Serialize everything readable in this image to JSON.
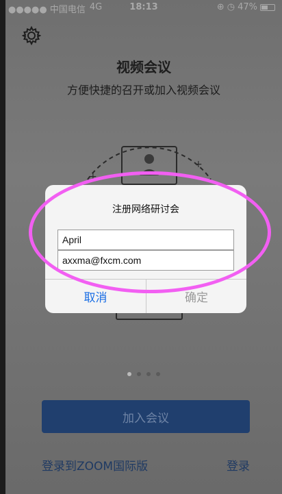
{
  "status_bar": {
    "carrier": "●●●●● 中国电信",
    "network": "4G",
    "time": "18:13",
    "battery": "47%"
  },
  "header": {
    "title": "视频会议",
    "subtitle": "方便快捷的召开或加入视频会议"
  },
  "dialog": {
    "title": "注册网络研讨会",
    "name_value": "April",
    "email_value": "axxma@fxcm.com",
    "cancel_label": "取消",
    "confirm_label": "确定"
  },
  "pager": {
    "count": 4,
    "active": 0
  },
  "actions": {
    "join_label": "加入会议",
    "login_international_label": "登录到ZOOM国际版",
    "login_label": "登录"
  },
  "colors": {
    "primary_button": "#203f6e",
    "link": "#1f3a63",
    "dialog_cancel": "#1a6ee4",
    "highlight": "#f25ff2"
  },
  "icons": [
    "settings-gear-icon",
    "battery-icon",
    "location-icon",
    "alarm-icon"
  ]
}
